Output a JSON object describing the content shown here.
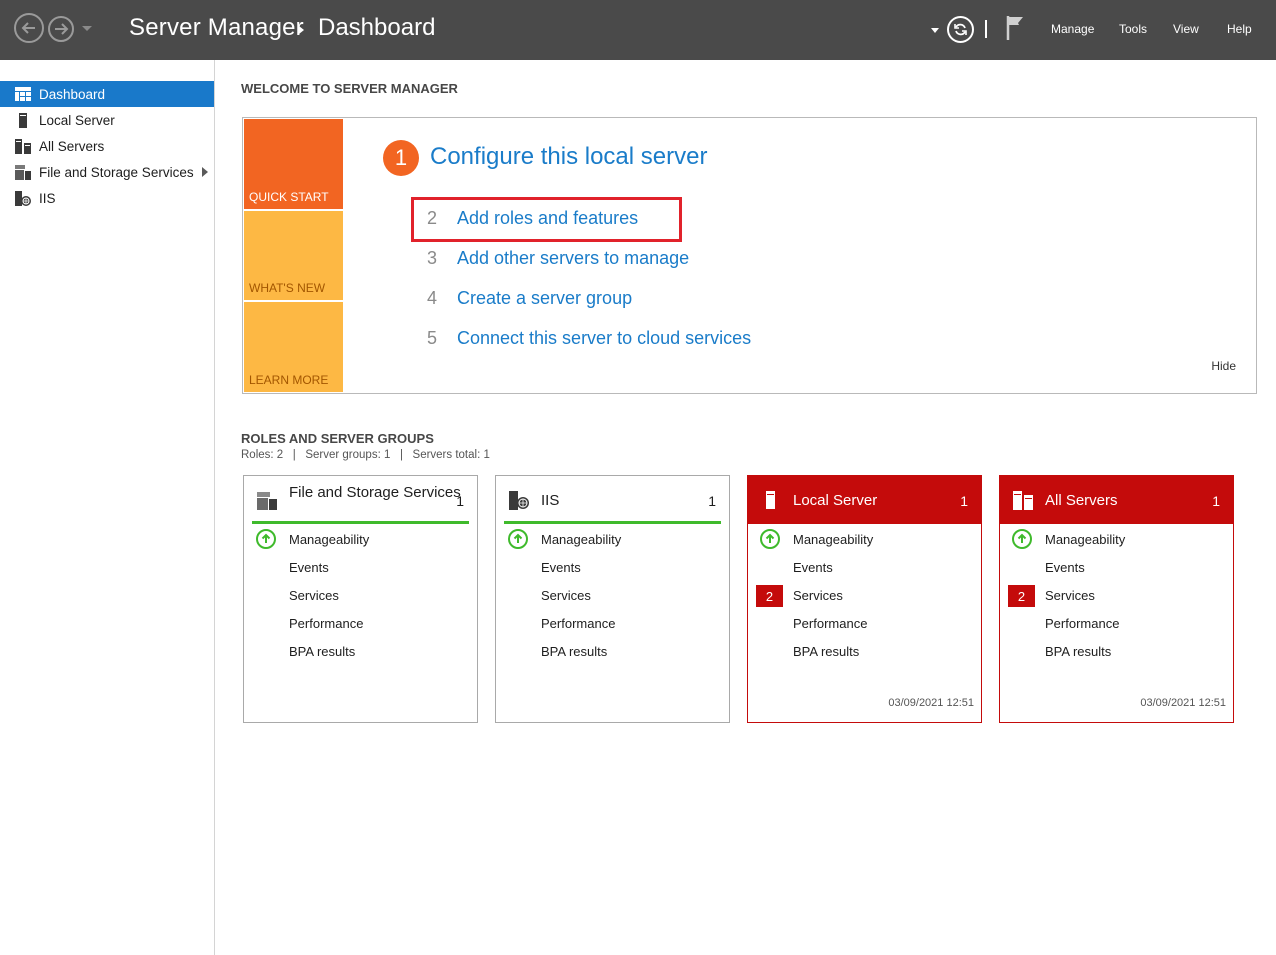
{
  "window": {
    "app_title": "Server Manager",
    "breadcrumb": "Dashboard",
    "menu": [
      "Manage",
      "Tools",
      "View",
      "Help"
    ]
  },
  "sidebar": {
    "items": [
      {
        "label": "Dashboard",
        "icon": "dashboard-icon",
        "active": true
      },
      {
        "label": "Local Server",
        "icon": "server-icon"
      },
      {
        "label": "All Servers",
        "icon": "servers-icon"
      },
      {
        "label": "File and Storage Services",
        "icon": "file-storage-icon"
      },
      {
        "label": "IIS",
        "icon": "iis-icon"
      }
    ]
  },
  "welcome": {
    "heading": "WELCOME TO SERVER MANAGER",
    "tiles": [
      "QUICK START",
      "WHAT'S NEW",
      "LEARN MORE"
    ],
    "step1": {
      "num": "1",
      "label": "Configure this local server"
    },
    "steps": [
      {
        "num": "2",
        "label": "Add roles and features"
      },
      {
        "num": "3",
        "label": "Add other servers to manage"
      },
      {
        "num": "4",
        "label": "Create a server group"
      },
      {
        "num": "5",
        "label": "Connect this server to cloud services"
      }
    ],
    "hide": "Hide"
  },
  "roles": {
    "heading": "ROLES AND SERVER GROUPS",
    "summary": "Roles: 2   |   Server groups: 1   |   Servers total: 1",
    "rows": [
      "Manageability",
      "Events",
      "Services",
      "Performance",
      "BPA results"
    ],
    "cards": [
      {
        "title": "File and Storage Services",
        "count": "1",
        "status": "ok",
        "icon": "file-storage-icon"
      },
      {
        "title": "IIS",
        "count": "1",
        "status": "ok",
        "icon": "iis-icon"
      },
      {
        "title": "Local Server",
        "count": "1",
        "status": "error",
        "icon": "server-icon",
        "services_alerts": "2",
        "timestamp": "03/09/2021 12:51"
      },
      {
        "title": "All Servers",
        "count": "1",
        "status": "error",
        "icon": "servers-icon",
        "services_alerts": "2",
        "timestamp": "03/09/2021 12:51"
      }
    ]
  },
  "colors": {
    "titlebar": "#4a4a4a",
    "accent_blue": "#1979ca",
    "link_blue": "#1a7cc9",
    "quick_start": "#f26522",
    "tile_yellow": "#fdb844",
    "alert_red": "#c40b0b",
    "ok_green": "#3fba2c",
    "highlight": "#e1222b"
  }
}
